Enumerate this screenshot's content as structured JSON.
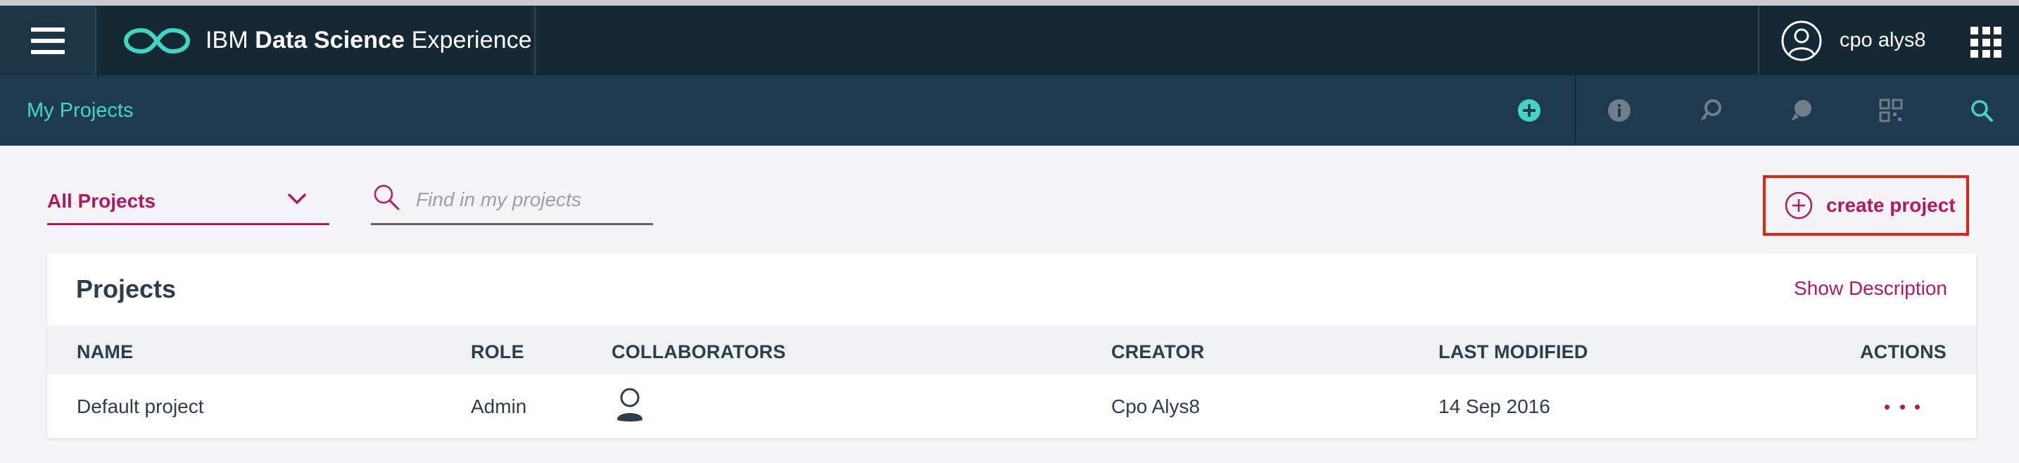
{
  "app": {
    "brand_prefix": "IBM ",
    "brand_bold": "Data Science",
    "brand_suffix": " Experience",
    "user_name": "cpo alys8"
  },
  "subheader": {
    "title": "My Projects",
    "toolbar_icons": [
      "add-circle-icon",
      "info-icon",
      "find-data-icon",
      "community-icon",
      "assets-grid-icon",
      "search-icon"
    ]
  },
  "filters": {
    "project_filter_value": "All Projects",
    "search_placeholder": "Find in my projects",
    "search_value": ""
  },
  "create_button": {
    "label": "create project"
  },
  "projects": {
    "title": "Projects",
    "show_description": "Show Description",
    "columns": {
      "name": "NAME",
      "role": "ROLE",
      "collaborators": "COLLABORATORS",
      "creator": "CREATOR",
      "last_modified": "LAST MODIFIED",
      "actions": "ACTIONS"
    },
    "rows": [
      {
        "name": "Default project",
        "role": "Admin",
        "collaborator_icon": "person-icon",
        "creator": "Cpo Alys8",
        "last_modified": "14 Sep 2016",
        "actions_icon": "more-options-icon"
      }
    ]
  },
  "colors": {
    "header_bg": "#152935",
    "subheader_bg": "#1e3a4f",
    "accent_teal": "#41d6c3",
    "accent_magenta": "#b5175f",
    "highlight_red": "#e2231a",
    "page_bg": "#f4f4f6"
  }
}
